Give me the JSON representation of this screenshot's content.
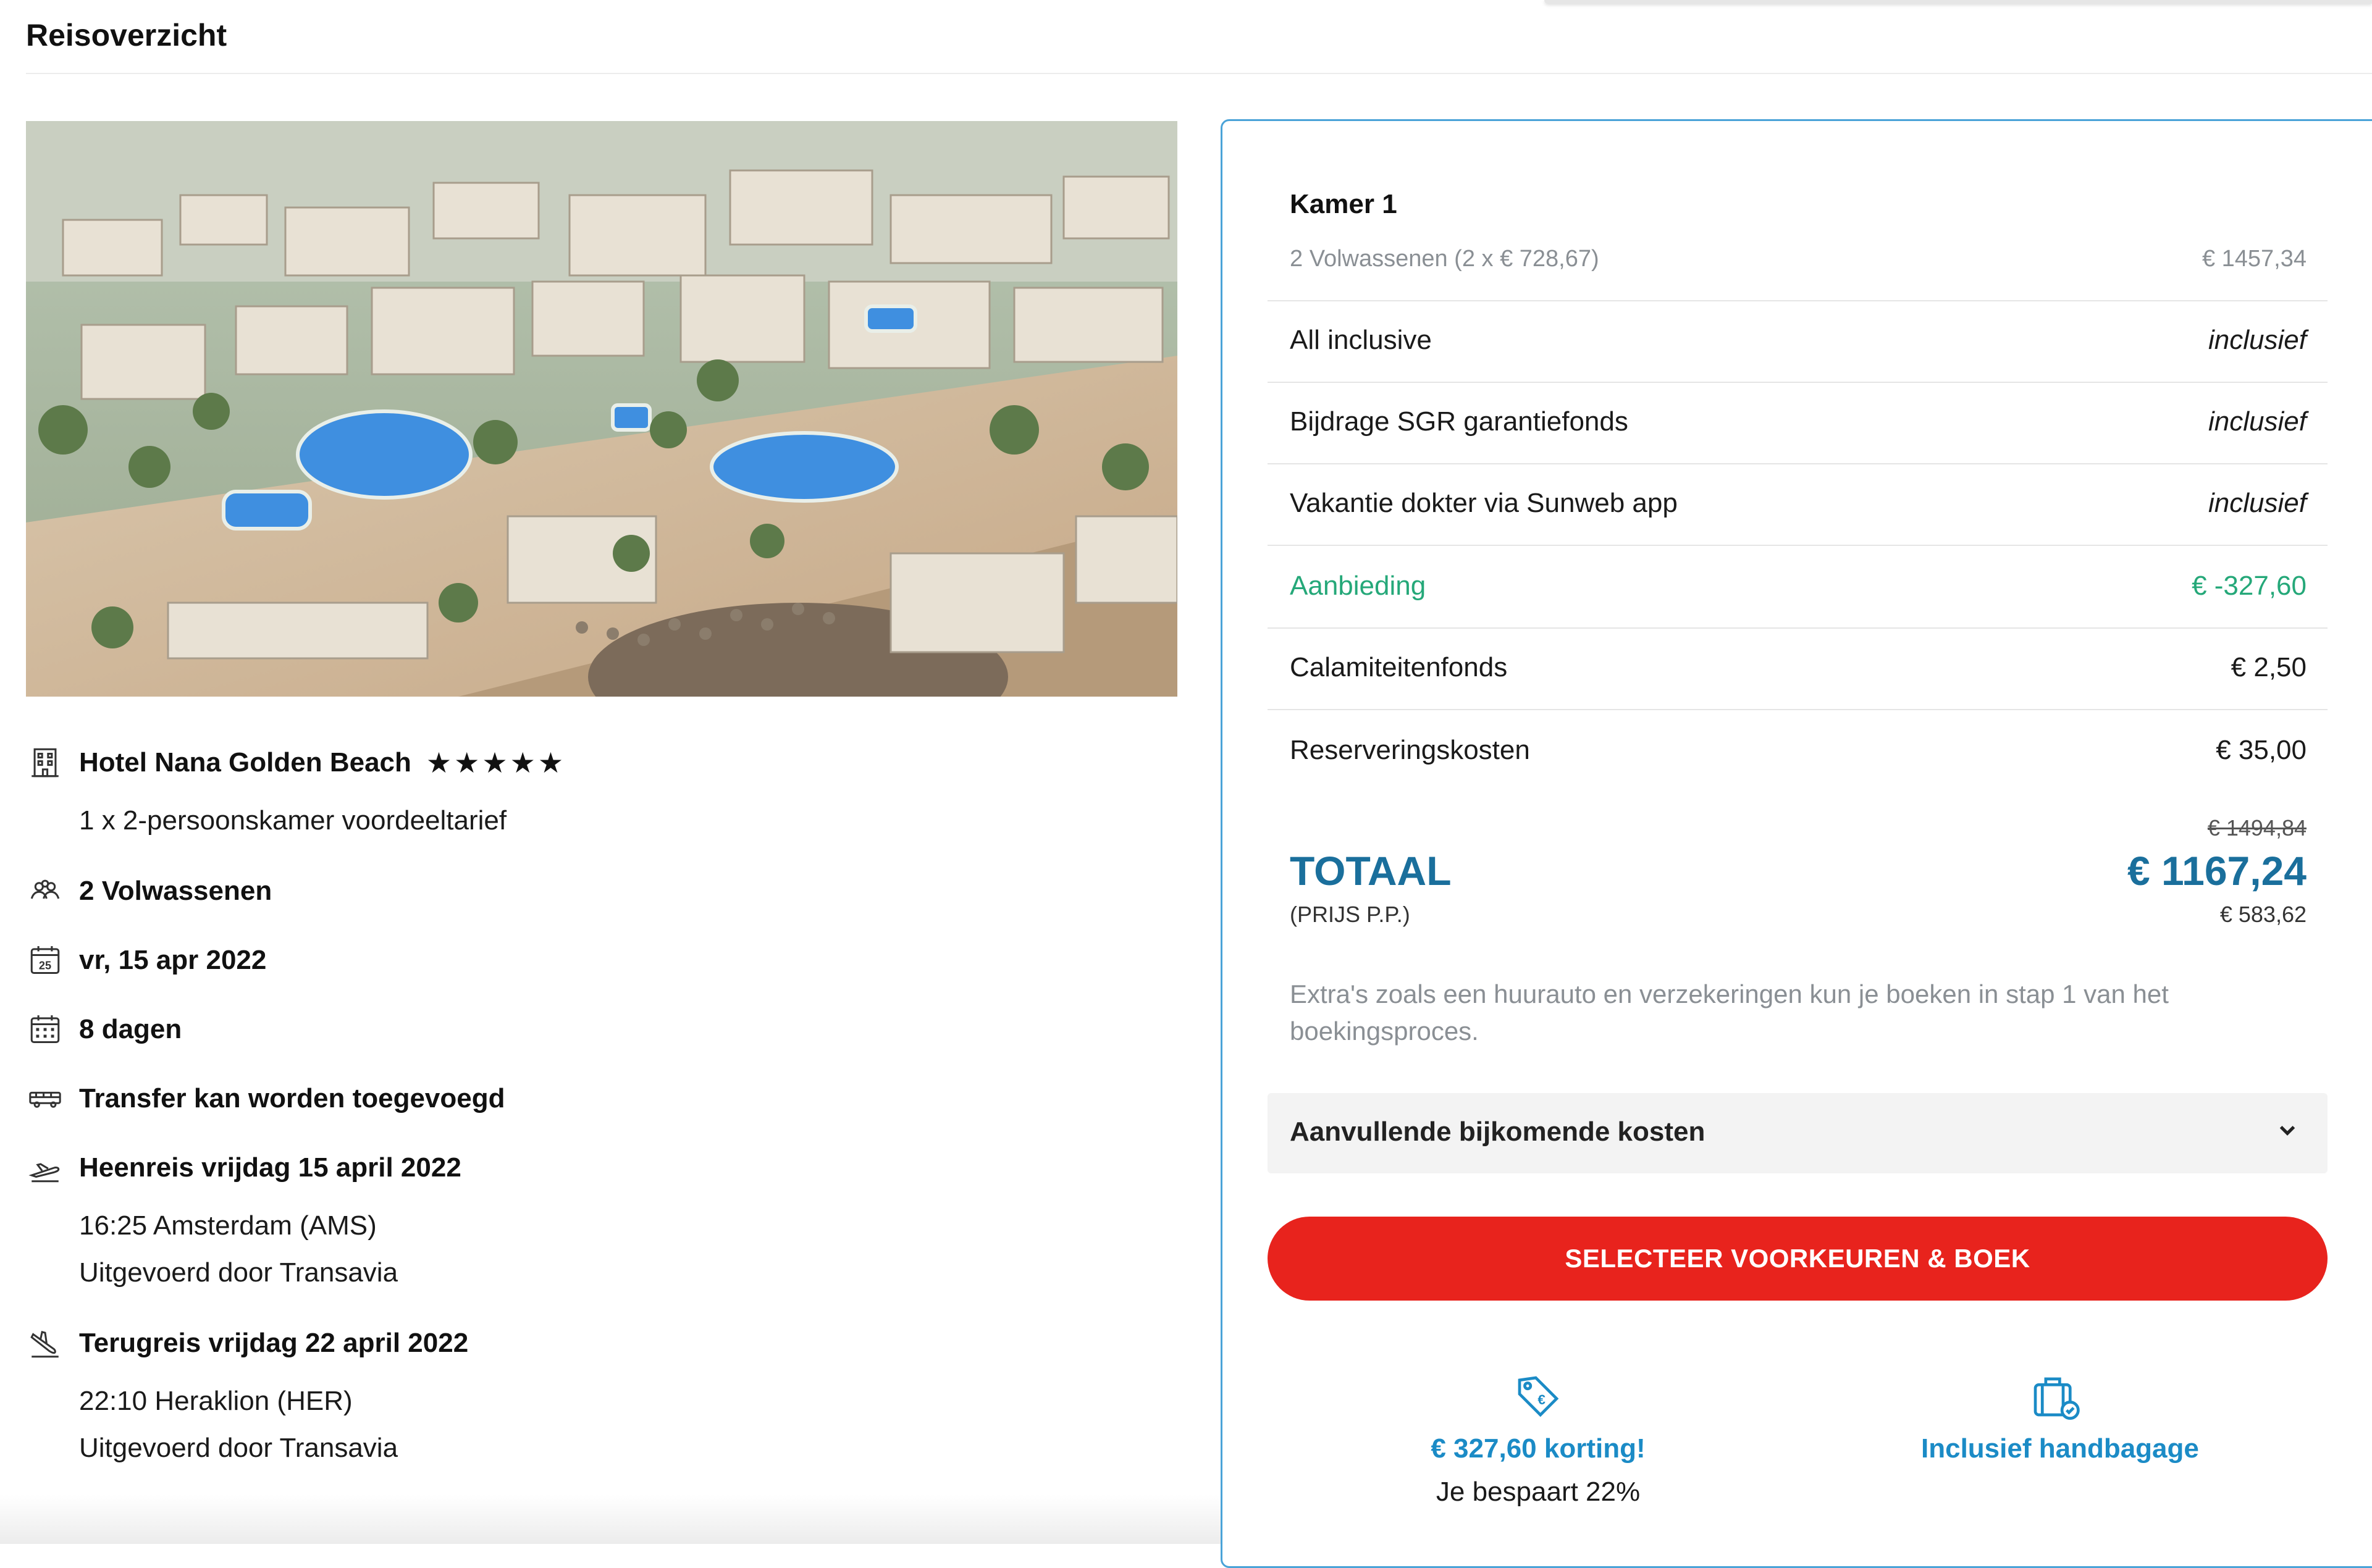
{
  "header": {
    "title": "Reisoverzicht"
  },
  "hotel": {
    "name": "Hotel Nana Golden Beach",
    "stars": 5,
    "room": "1 x 2-persoonskamer voordeeltarief"
  },
  "details": {
    "travelers": "2 Volwassenen",
    "date_icon_day": "25",
    "date": "vr, 15 apr 2022",
    "duration": "8 dagen",
    "transfer": "Transfer kan worden toegevoegd",
    "outbound": {
      "title": "Heenreis vrijdag 15 april 2022",
      "time_place": "16:25 Amsterdam (AMS)",
      "operator": "Uitgevoerd door Transavia"
    },
    "return": {
      "title": "Terugreis vrijdag 22 april 2022",
      "time_place": "22:10 Heraklion (HER)",
      "operator": "Uitgevoerd door Transavia"
    }
  },
  "price": {
    "room": {
      "title": "Kamer 1",
      "sub": "2 Volwassenen (2 x € 728,67)",
      "amount": "€ 1457,34"
    },
    "items": [
      {
        "label": "All inclusive",
        "value": "inclusief"
      },
      {
        "label": "Bijdrage SGR garantiefonds",
        "value": "inclusief"
      },
      {
        "label": "Vakantie dokter via Sunweb app",
        "value": "inclusief"
      },
      {
        "label": "Aanbieding",
        "value": "€ -327,60"
      },
      {
        "label": "Calamiteitenfonds",
        "value": "€ 2,50"
      },
      {
        "label": "Reserveringskosten",
        "value": "€ 35,00"
      }
    ],
    "old_total": "€ 1494,84",
    "total_label": "TOTAAL",
    "total_value": "€ 1167,24",
    "pp_label": "(PRIJS P.P.)",
    "pp_value": "€ 583,62",
    "extras_note": "Extra's zoals een huurauto en verzekeringen kun je boeken in stap 1 van het boekingsproces.",
    "accordion_label": "Aanvullende bijkomende kosten",
    "cta_label": "SELECTEER VOORKEUREN & BOEK"
  },
  "perks": {
    "discount": {
      "title": "€ 327,60 korting!",
      "sub": "Je bespaart 22%"
    },
    "baggage": {
      "title": "Inclusief handbagage"
    }
  },
  "colors": {
    "accent_blue": "#1b8bc6",
    "total_blue": "#1a6f9c",
    "offer_green": "#25a879",
    "cta_red": "#e8231d",
    "panel_border": "#4aa3d8"
  },
  "icons": {
    "hotel": "hotel-building-icon",
    "travelers": "people-icon",
    "date": "calendar-day-icon",
    "duration": "calendar-grid-icon",
    "transfer": "bus-icon",
    "outbound": "plane-takeoff-icon",
    "return": "plane-landing-icon",
    "discount": "price-tag-icon",
    "baggage": "suitcase-check-icon",
    "accordion": "chevron-down-icon"
  }
}
